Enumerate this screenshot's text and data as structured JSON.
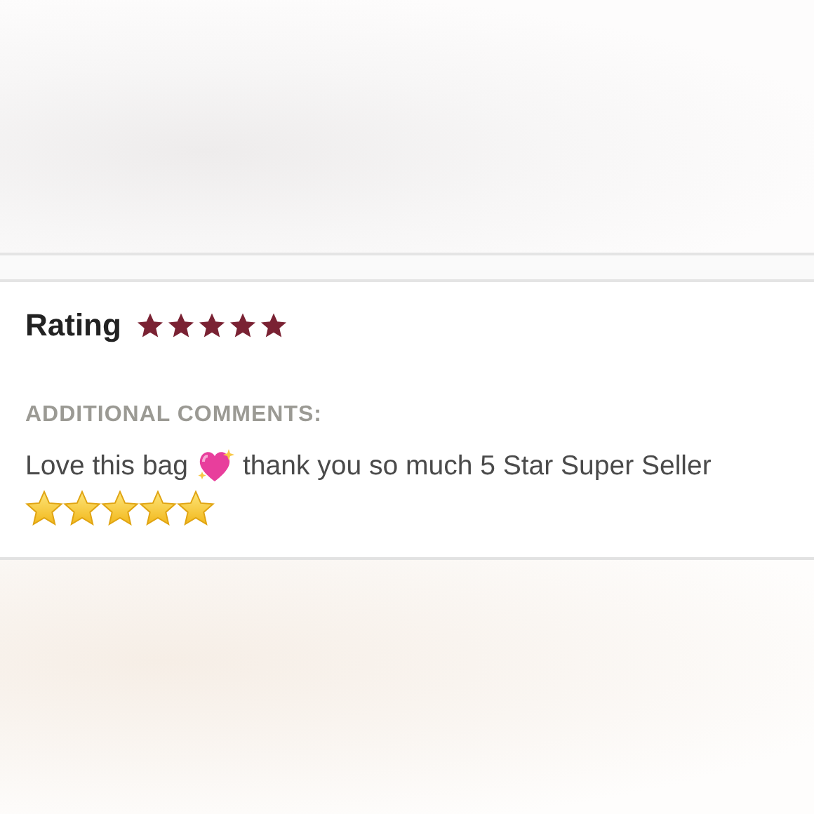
{
  "rating": {
    "label": "Rating",
    "stars": 5
  },
  "comments": {
    "heading": "ADDITIONAL COMMENTS:",
    "parts": [
      {
        "kind": "text",
        "text": "Love this bag"
      },
      {
        "kind": "heart"
      },
      {
        "kind": "text",
        "text": "thank you so much 5 Star Super Seller"
      },
      {
        "kind": "star"
      },
      {
        "kind": "star"
      },
      {
        "kind": "star"
      },
      {
        "kind": "star"
      },
      {
        "kind": "star"
      }
    ]
  }
}
